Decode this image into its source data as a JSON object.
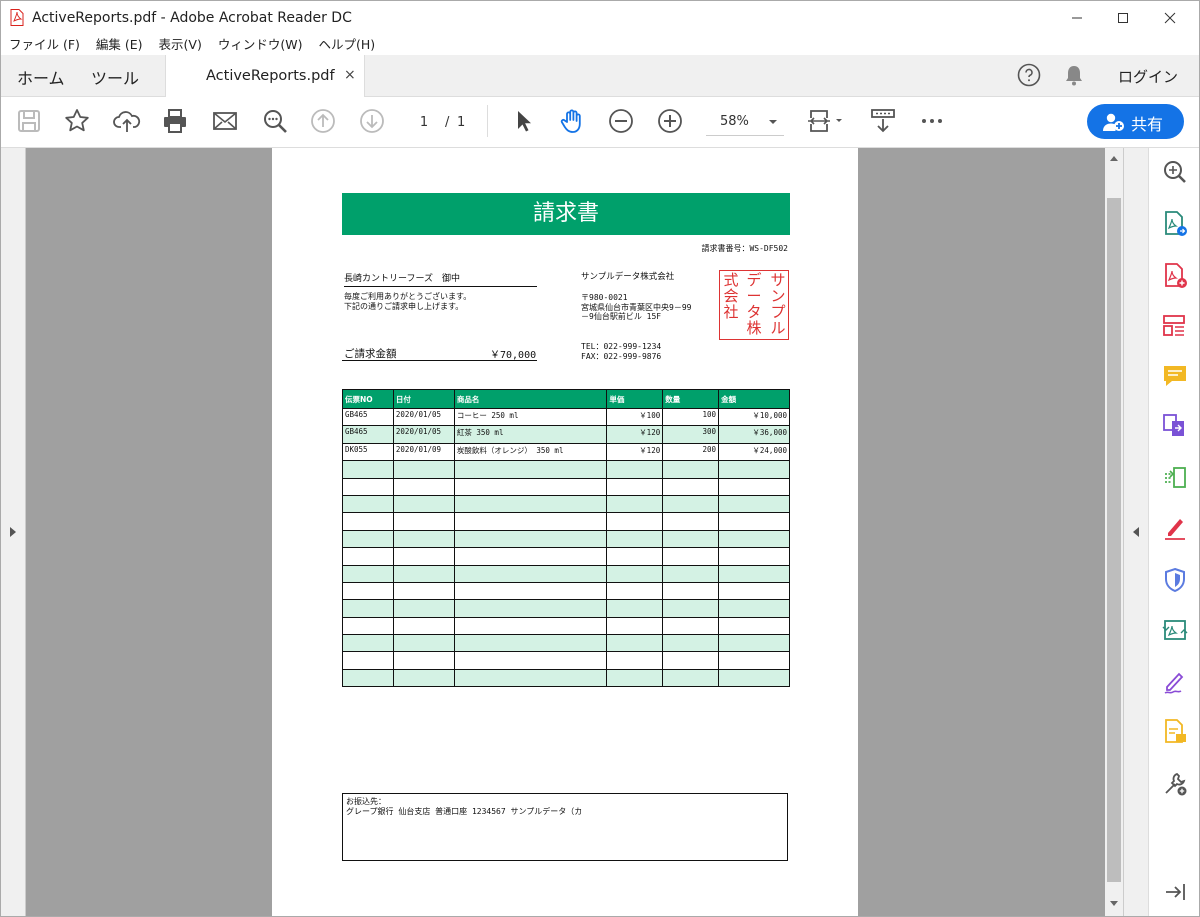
{
  "window": {
    "title": "ActiveReports.pdf - Adobe Acrobat Reader DC"
  },
  "menu": [
    "ファイル (F)",
    "編集 (E)",
    "表示(V)",
    "ウィンドウ(W)",
    "ヘルプ(H)"
  ],
  "tabs": {
    "home": "ホーム",
    "tools": "ツール",
    "document": "ActiveReports.pdf",
    "close": "×"
  },
  "header_right": {
    "login": "ログイン"
  },
  "toolbar": {
    "page_current": "1",
    "page_sep": "/",
    "page_total": "1",
    "zoom": "58%",
    "share_label": "共有"
  },
  "colors": {
    "accent_green": "#00a06b",
    "row_alt": "#d4f2e4",
    "share_blue": "#1473e6",
    "stamp_red": "#d33333"
  },
  "invoice": {
    "title": "請求書",
    "number": "請求書番号：WS-DF502",
    "customer": "長崎カントリーフーズ　御中",
    "greeting_1": "毎度ご利用ありがとうございます。",
    "greeting_2": "下記の通りご請求申し上げます。",
    "amount_label": "ご請求金額",
    "amount_value": "￥70,000",
    "company": "サンプルデータ株式会社",
    "postal": "〒980-0021",
    "address_1": "宮城県仙台市青葉区中央9－99",
    "address_2": "－9仙台駅前ビル 15F",
    "tel": "TEL：022-999-1234",
    "fax": "FAX：022-999-9876",
    "stamp_cols": [
      "サン\nプル",
      "デー\nタ株",
      "式会\n社"
    ],
    "columns": [
      "伝票NO",
      "日付",
      "商品名",
      "単価",
      "数量",
      "金額"
    ],
    "rows": [
      [
        "GB465",
        "2020/01/05",
        "コーヒー 250 ml",
        "￥100",
        "100",
        "￥10,000"
      ],
      [
        "GB465",
        "2020/01/05",
        "紅茶 350 ml",
        "￥120",
        "300",
        "￥36,000"
      ],
      [
        "DK055",
        "2020/01/09",
        "炭酸飲料（オレンジ） 350 ml",
        "￥120",
        "200",
        "￥24,000"
      ]
    ],
    "empty_rows": 13,
    "remit_label": "お振込先：",
    "remit_text": "グレープ銀行 仙台支店 普通口座 1234567 サンプルデータ（カ"
  }
}
